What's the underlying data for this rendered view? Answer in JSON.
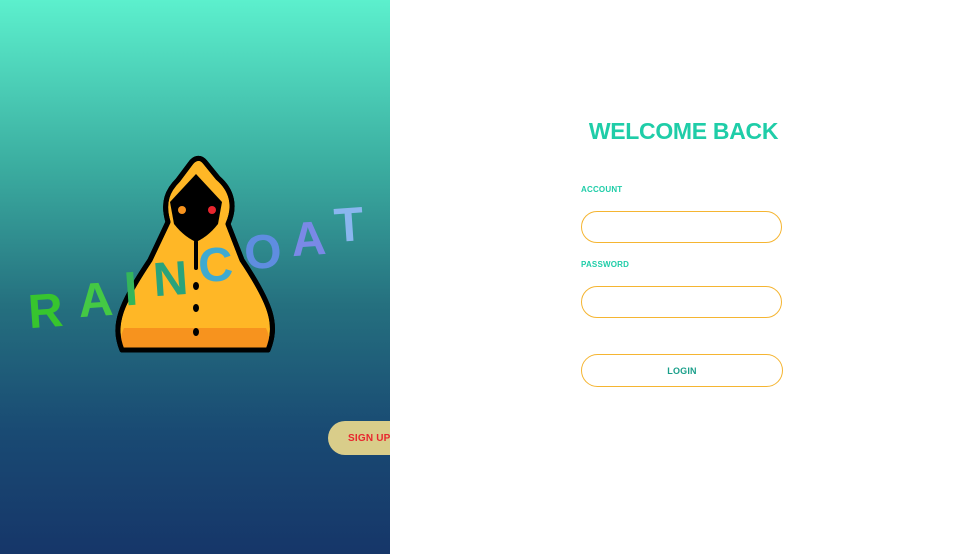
{
  "brand": {
    "letters": [
      "R",
      "A",
      "I",
      "N",
      "C",
      "O",
      "A",
      "T"
    ]
  },
  "auth": {
    "signup_label": "SIGN UP",
    "title": "WELCOME BACK",
    "account_label": "ACCOUNT",
    "account_value": "",
    "password_label": "PASSWORD",
    "password_value": "",
    "login_label": "LOGIN"
  },
  "colors": {
    "accent": "#1fcda8",
    "input_border": "#f5b532",
    "signup_bg": "#d9cd8a",
    "signup_text": "#e8262e",
    "mascot_yellow": "#ffb726",
    "mascot_orange": "#f7931e"
  }
}
